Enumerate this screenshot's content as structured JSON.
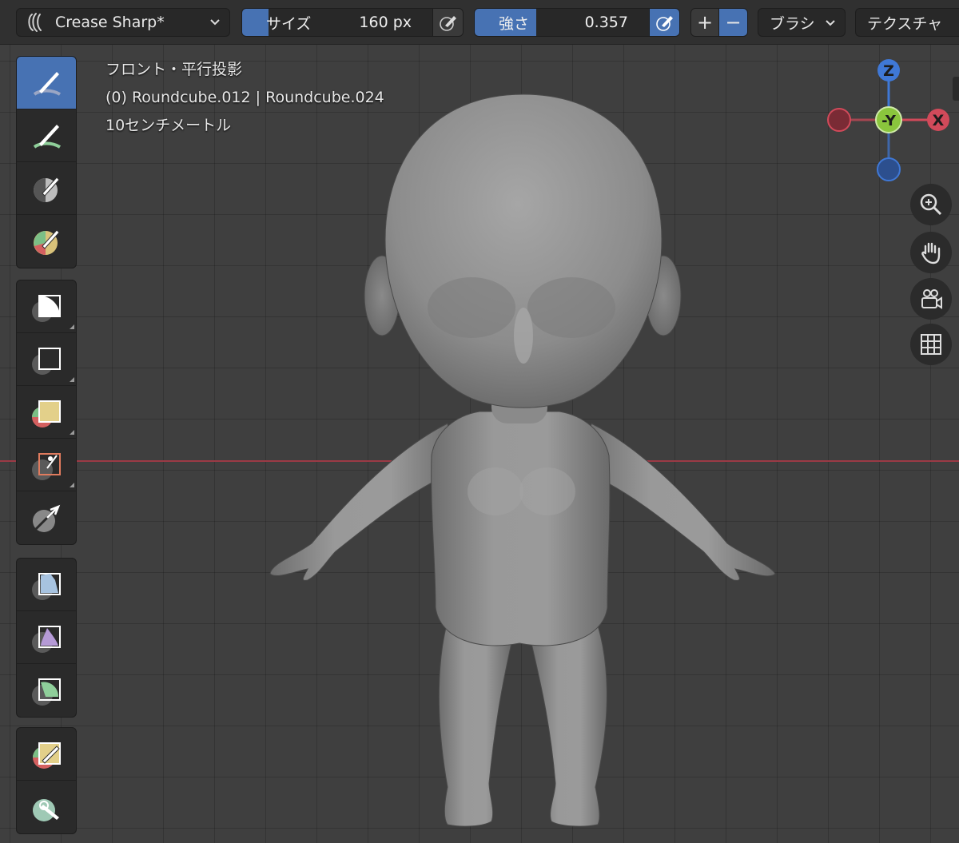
{
  "header": {
    "brush_name": "Crease Sharp*",
    "size_label": "サイズ",
    "size_value": "160 px",
    "size_fill_fraction": 0.12,
    "strength_label": "強さ",
    "strength_value": "0.357",
    "strength_fill_fraction": 0.3,
    "plus": "+",
    "minus": "−",
    "brush_menu": "ブラシ",
    "texture_menu": "テクスチャ"
  },
  "overlay": {
    "view_name": "フロント・平行投影",
    "object_info": "(0) Roundcube.012 | Roundcube.024",
    "scale": "10センチメートル"
  },
  "gizmo": {
    "z_label": "Z",
    "y_label": "-Y",
    "x_label": "X",
    "x_color": "#d14a5a",
    "y_color": "#8ac53d",
    "z_color": "#3f78d6"
  },
  "colors": {
    "accent": "#4772b3",
    "axis_x_line": "#9b3a45"
  },
  "toolbar": {
    "groups": [
      [
        "brush-draw-icon",
        "brush-smooth-icon",
        "brush-mask-icon",
        "brush-face-set-icon"
      ],
      [
        "box-trim-icon",
        "box-hide-icon",
        "box-face-set-icon",
        "line-project-icon",
        "mesh-filter-icon"
      ],
      [
        "cloth-filter-icon",
        "color-filter-icon",
        "edit-face-set-icon"
      ],
      [
        "paint-icon",
        "transform-icon"
      ]
    ]
  }
}
